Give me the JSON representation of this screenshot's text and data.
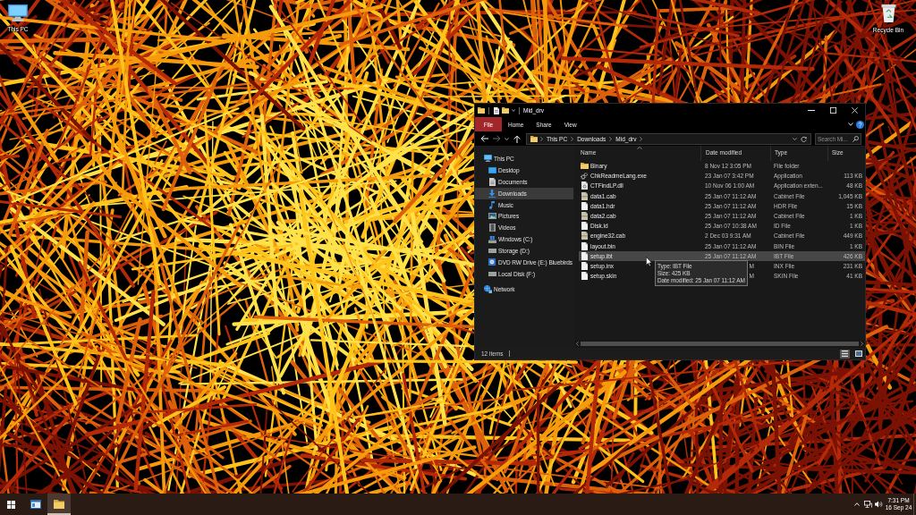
{
  "desktop": {
    "icons": [
      {
        "kind": "computer",
        "label": "This PC"
      },
      {
        "kind": "recycle-bin",
        "label": "Recycle Bin"
      }
    ]
  },
  "window": {
    "title": "Mid_drv",
    "ribbon_tabs": [
      {
        "kind": "file-menu",
        "label": "File",
        "selected": false
      },
      {
        "kind": "tab",
        "label": "Home",
        "selected": false
      },
      {
        "kind": "tab",
        "label": "Share",
        "selected": false
      },
      {
        "kind": "tab",
        "label": "View",
        "selected": false
      }
    ],
    "breadcrumbs": [
      "This PC",
      "Downloads",
      "Mid_drv"
    ],
    "search": {
      "placeholder": "Search Mi..."
    },
    "navigation": [
      {
        "kind": "computer",
        "label": "This PC",
        "selected": false,
        "children": [
          {
            "kind": "desktop",
            "label": "Desktop",
            "selected": false
          },
          {
            "kind": "documents",
            "label": "Documents",
            "selected": false
          },
          {
            "kind": "downloads",
            "label": "Downloads",
            "selected": true
          },
          {
            "kind": "music",
            "label": "Music",
            "selected": false
          },
          {
            "kind": "pictures",
            "label": "Pictures",
            "selected": false
          },
          {
            "kind": "videos",
            "label": "Videos",
            "selected": false
          },
          {
            "kind": "system-drive",
            "label": "Windows (C:)",
            "selected": false
          },
          {
            "kind": "drive",
            "label": "Storage (D:)",
            "selected": false
          },
          {
            "kind": "optical-drive",
            "label": "DVD RW Drive (E:) Bluebirds",
            "selected": false
          },
          {
            "kind": "drive",
            "label": "Local Disk (F:)",
            "selected": false
          }
        ]
      },
      {
        "kind": "network",
        "label": "Network",
        "selected": false
      }
    ],
    "columns": [
      {
        "label": "Name",
        "sorted": true
      },
      {
        "label": "Date modified",
        "sorted": false
      },
      {
        "label": "Type",
        "sorted": false
      },
      {
        "label": "Size",
        "sorted": false
      }
    ],
    "files": [
      {
        "kind": "folder",
        "name": "Binary",
        "date": "8 Nov 12 3:05 PM",
        "date_covered": false,
        "type": "File folder",
        "hovered": false
      },
      {
        "kind": "application",
        "name": "ChkReadmeLang.exe",
        "date": "23 Jan 07 3:42 PM",
        "date_covered": false,
        "type": "Application",
        "size": "113 KB",
        "hovered": false
      },
      {
        "kind": "extension",
        "name": "CTFindLP.dll",
        "date": "10 Nov 06 1:00 AM",
        "date_covered": false,
        "type": "Application exten...",
        "size": "48 KB",
        "hovered": false
      },
      {
        "kind": "cabinet",
        "name": "data1.cab",
        "date": "25 Jan 07 11:12 AM",
        "date_covered": false,
        "type": "Cabinet File",
        "size": "1,045 KB",
        "hovered": false
      },
      {
        "kind": "file",
        "name": "data1.hdr",
        "date": "25 Jan 07 11:12 AM",
        "date_covered": false,
        "type": "HDR File",
        "size": "15 KB",
        "hovered": false
      },
      {
        "kind": "cabinet",
        "name": "data2.cab",
        "date": "25 Jan 07 11:12 AM",
        "date_covered": false,
        "type": "Cabinet File",
        "size": "1 KB",
        "hovered": false
      },
      {
        "kind": "file",
        "name": "Disk.id",
        "date": "25 Jan 07 10:38 AM",
        "date_covered": false,
        "type": "ID File",
        "size": "1 KB",
        "hovered": false
      },
      {
        "kind": "cabinet",
        "name": "engine32.cab",
        "date": "2 Dec 03 9:31 AM",
        "date_covered": false,
        "type": "Cabinet File",
        "size": "449 KB",
        "hovered": false
      },
      {
        "kind": "file",
        "name": "layout.bin",
        "date": "25 Jan 07 11:12 AM",
        "date_covered": false,
        "type": "BIN File",
        "size": "1 KB",
        "hovered": false
      },
      {
        "kind": "file",
        "name": "setup.ibt",
        "date": "25 Jan 07 11:12 AM",
        "date_covered": false,
        "type": "IBT File",
        "size": "426 KB",
        "hovered": true
      },
      {
        "kind": "file",
        "name": "setup.inx",
        "date": "M",
        "date_covered": true,
        "type": "INX File",
        "size": "231 KB",
        "hovered": false
      },
      {
        "kind": "file",
        "name": "setup.skin",
        "date": "M",
        "date_covered": true,
        "type": "SKIN File",
        "size": "41 KB",
        "hovered": false
      }
    ],
    "tooltip": {
      "lines": [
        "Type: IBT File",
        "Size: 425 KB",
        "Date modified: 25 Jan 07 11:12 AM"
      ]
    },
    "status_bar": {
      "item_count": "12 items"
    },
    "view_buttons": [
      {
        "kind": "details",
        "selected": true
      },
      {
        "kind": "large-icons",
        "selected": false
      }
    ]
  },
  "taskbar": {
    "apps": [
      {
        "kind": "window",
        "active": false
      },
      {
        "kind": "folder",
        "active": true
      }
    ],
    "clock": {
      "time": "7:31 PM",
      "date": "16 Sep 24"
    }
  }
}
